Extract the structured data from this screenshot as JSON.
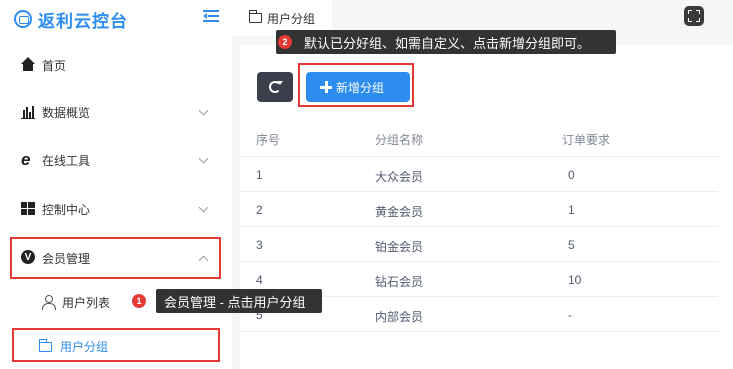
{
  "brand": {
    "title": "返利云控台"
  },
  "tab": {
    "label": "用户分组"
  },
  "sidebar": {
    "items": [
      {
        "label": "首页"
      },
      {
        "label": "数据概览"
      },
      {
        "label": "在线工具"
      },
      {
        "label": "控制中心"
      },
      {
        "label": "会员管理"
      }
    ],
    "sub_items": [
      {
        "label": "用户列表"
      },
      {
        "label": "用户分组"
      }
    ]
  },
  "toolbar": {
    "add_label": "新增分组"
  },
  "table": {
    "headers": [
      "序号",
      "分组名称",
      "订单要求"
    ],
    "rows": [
      [
        "1",
        "大众会员",
        "0"
      ],
      [
        "2",
        "黄金会员",
        "1"
      ],
      [
        "3",
        "铂金会员",
        "5"
      ],
      [
        "4",
        "钻石会员",
        "10"
      ],
      [
        "5",
        "内部会员",
        "-"
      ]
    ]
  },
  "tooltips": [
    {
      "num": "1",
      "text": "会员管理 - 点击用户分组"
    },
    {
      "num": "2",
      "text": "默认已分好组、如需自定义、点击新增分组即可。"
    }
  ],
  "colors": {
    "accent": "#2d8cf0",
    "highlight": "#e53935",
    "dark": "#333333"
  }
}
